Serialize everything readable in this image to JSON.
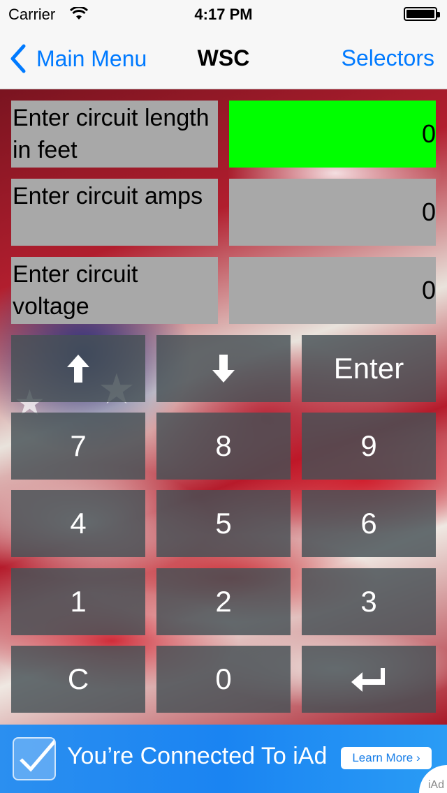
{
  "status_bar": {
    "carrier": "Carrier",
    "time": "4:17 PM"
  },
  "nav": {
    "back_label": "Main Menu",
    "title": "WSC",
    "right_label": "Selectors",
    "accent_color": "#007aff"
  },
  "inputs": [
    {
      "label": "Enter circuit length in feet",
      "value": "0",
      "active": true
    },
    {
      "label": "Enter circuit amps",
      "value": "0",
      "active": false
    },
    {
      "label": "Enter circuit voltage",
      "value": "0",
      "active": false
    }
  ],
  "keypad": {
    "up_icon": "arrow-up-icon",
    "down_icon": "arrow-down-icon",
    "enter": "Enter",
    "k7": "7",
    "k8": "8",
    "k9": "9",
    "k4": "4",
    "k5": "5",
    "k6": "6",
    "k1": "1",
    "k2": "2",
    "k3": "3",
    "clear": "C",
    "k0": "0",
    "return_icon": "return-icon"
  },
  "ad": {
    "text": "You’re Connected To iAd",
    "button": "Learn More ›",
    "logo": "iAd"
  },
  "colors": {
    "active_field": "#00ff00",
    "field_bg": "#a8a8a8",
    "key_bg": "#465055"
  }
}
